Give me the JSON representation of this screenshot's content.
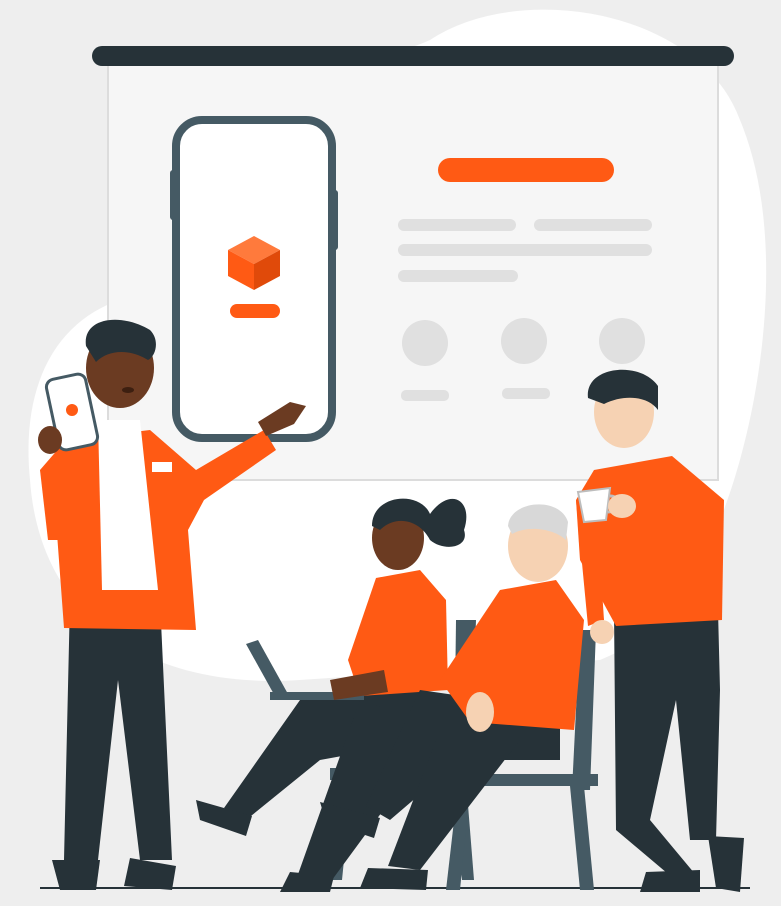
{
  "colors": {
    "background": "#eeeeee",
    "backdrop_blob": "#ffffff",
    "screen": "#f6f6f6",
    "accent": "#ff5a14",
    "dark": "#263238",
    "frame": "#455a64",
    "placeholder_gray": "#e0e0e0",
    "skin_dark": "#6b3b22",
    "skin_light": "#f6d2b3"
  },
  "icons": {
    "product_box": "cube-icon",
    "phone_box": "cube-icon"
  },
  "scene": {
    "description_items": [
      "presentation-screen",
      "phone-mockup",
      "presenter",
      "seated-woman-with-laptop",
      "seated-older-man",
      "standing-man-with-cup"
    ]
  }
}
